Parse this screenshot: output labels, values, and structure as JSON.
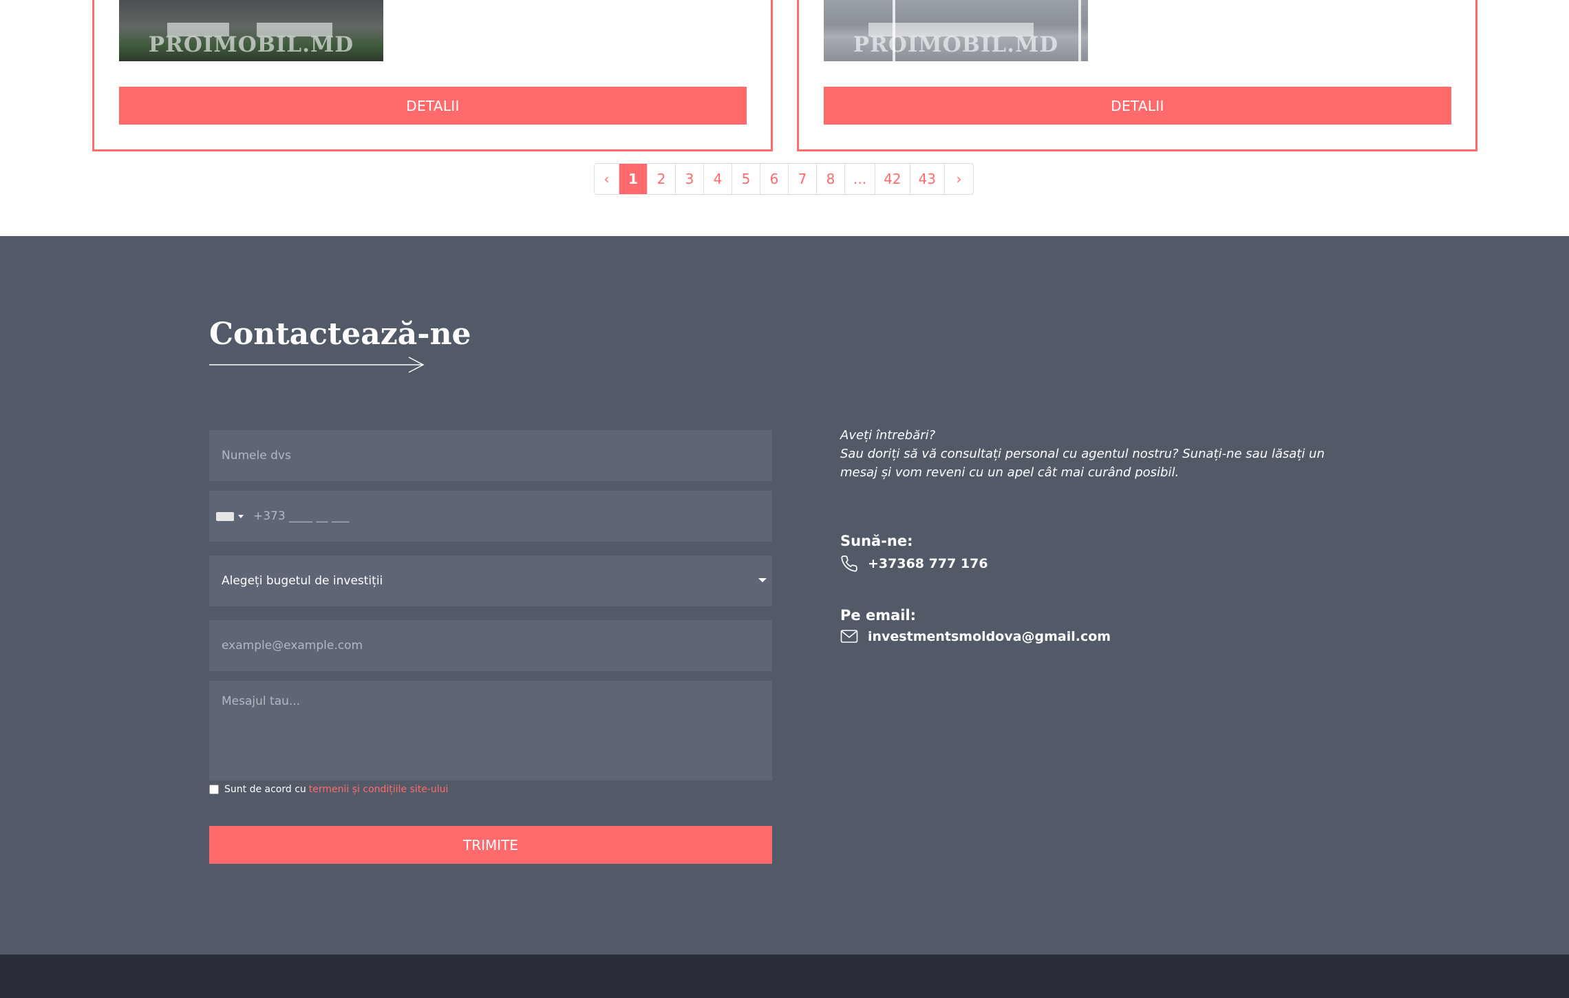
{
  "cards": [
    {
      "watermark": "PROIMOBIL.MD",
      "button": "DETALII"
    },
    {
      "watermark": "PROIMOBIL.MD",
      "button": "DETALII"
    }
  ],
  "pagination": {
    "prev": "‹",
    "pages": [
      "1",
      "2",
      "3",
      "4",
      "5",
      "6",
      "7",
      "8",
      "...",
      "42",
      "43"
    ],
    "active": "1",
    "next": "›"
  },
  "contact": {
    "title": "Contactează-ne",
    "form": {
      "name_placeholder": "Numele dvs",
      "phone_placeholder": "+373 ____ __ ___",
      "budget_selected": "Alegeți bugetul de investiții",
      "email_placeholder": "example@example.com",
      "message_placeholder": "Mesajul tau...",
      "agree_text": "Sunt de acord cu",
      "agree_link": "termenii și condițiile site-ului",
      "submit": "TRIMITE"
    },
    "info": {
      "question": "Aveți întrebări?",
      "text": "Sau doriți să vă consultați personal cu agentul nostru? Sunați-ne sau lăsați un mesaj și vom reveni cu un apel cât mai curând posibil.",
      "call_label": "Sună-ne:",
      "phone": "+37368 777 176",
      "email_label": "Pe email:",
      "email": "investmentsmoldova@gmail.com"
    }
  },
  "colors": {
    "accent": "#ff6b6d",
    "section_bg": "#525a68",
    "field_bg": "#5e6675",
    "footer_bg": "#292e38"
  }
}
